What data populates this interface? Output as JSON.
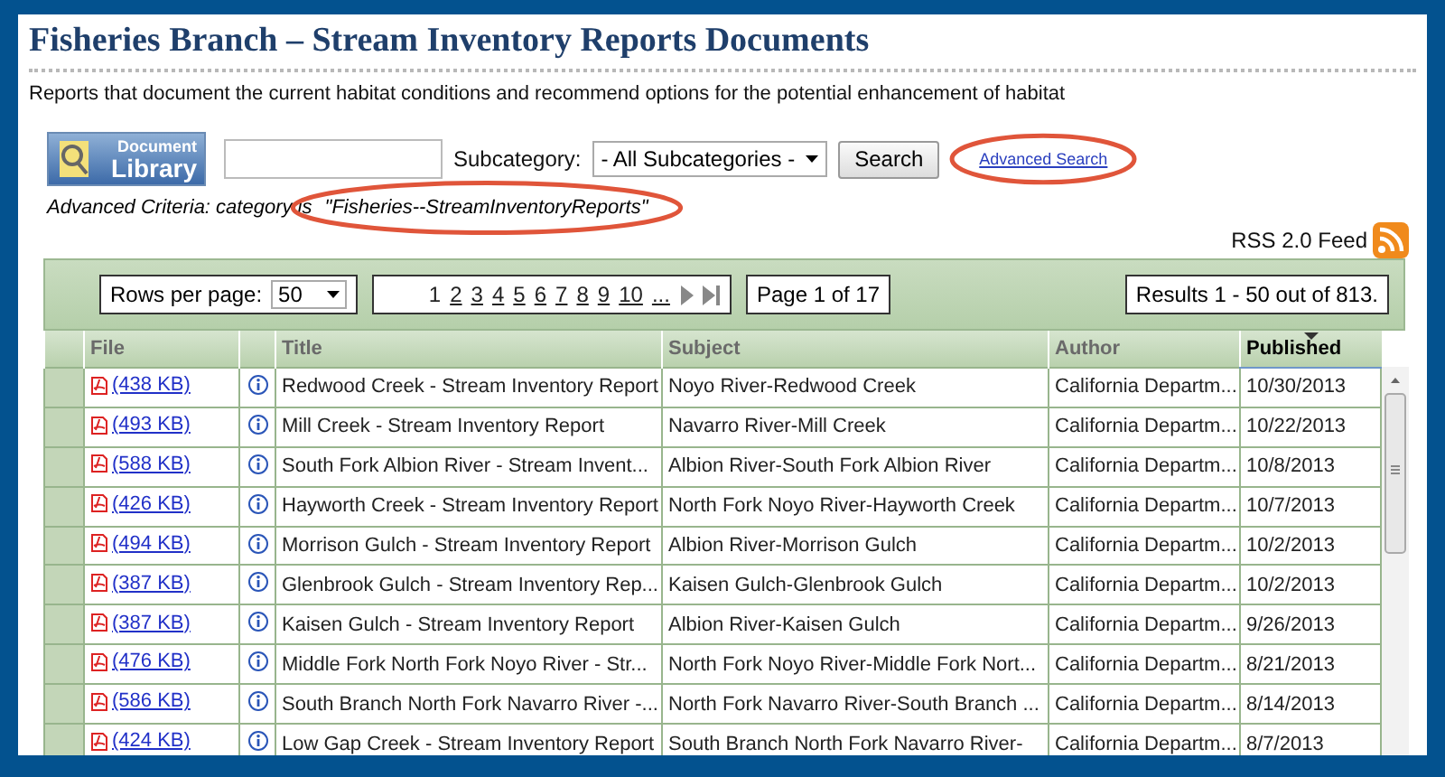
{
  "page": {
    "title": "Fisheries Branch – Stream Inventory Reports Documents",
    "description": "Reports that document the current habitat conditions and recommend options for the potential enhancement of habitat"
  },
  "search": {
    "logo_lines": [
      "Document",
      "Library"
    ],
    "subcategory_label": "Subcategory:",
    "subcategory_value": "- All Subcategories -",
    "button": "Search",
    "advanced_link": "Advanced Search",
    "criteria": "Advanced Criteria: category is",
    "criteria_value": "\"Fisheries--StreamInventoryReports\""
  },
  "rss": {
    "label": "RSS 2.0 Feed"
  },
  "pager": {
    "rows_label": "Rows per page:",
    "rows_value": "50",
    "pages": [
      {
        "label": "1",
        "selected": true
      },
      {
        "label": "2",
        "selected": false
      },
      {
        "label": "3",
        "selected": false
      },
      {
        "label": "4",
        "selected": false
      },
      {
        "label": "5",
        "selected": false
      },
      {
        "label": "6",
        "selected": false
      },
      {
        "label": "7",
        "selected": false
      },
      {
        "label": "8",
        "selected": false
      },
      {
        "label": "9",
        "selected": false
      },
      {
        "label": "10",
        "selected": false
      }
    ],
    "more": "...",
    "page_info": "Page 1 of 17",
    "results": "Results 1 - 50 out of 813."
  },
  "table": {
    "columns": [
      {
        "label": "File",
        "sorted": false
      },
      {
        "label": "Title",
        "sorted": false
      },
      {
        "label": "Subject",
        "sorted": false
      },
      {
        "label": "Author",
        "sorted": false
      },
      {
        "label": "Published",
        "sorted": true
      }
    ],
    "rows": [
      {
        "file": "(438 KB)",
        "title": "Redwood Creek - Stream Inventory Report",
        "subject": "Noyo River-Redwood Creek",
        "author": "California Departm...",
        "published": "10/30/2013"
      },
      {
        "file": "(493 KB)",
        "title": "Mill Creek - Stream Inventory Report",
        "subject": "Navarro River-Mill Creek",
        "author": "California Departm...",
        "published": "10/22/2013"
      },
      {
        "file": "(588 KB)",
        "title": "South Fork Albion River - Stream Invent...",
        "subject": "Albion River-South Fork Albion River",
        "author": "California Departm...",
        "published": "10/8/2013"
      },
      {
        "file": "(426 KB)",
        "title": "Hayworth Creek - Stream Inventory Report",
        "subject": "North Fork Noyo River-Hayworth Creek",
        "author": "California Departm...",
        "published": "10/7/2013"
      },
      {
        "file": "(494 KB)",
        "title": "Morrison Gulch - Stream Inventory Report",
        "subject": "Albion River-Morrison Gulch",
        "author": "California Departm...",
        "published": "10/2/2013"
      },
      {
        "file": "(387 KB)",
        "title": "Glenbrook Gulch - Stream Inventory Rep...",
        "subject": "Kaisen Gulch-Glenbrook Gulch",
        "author": "California Departm...",
        "published": "10/2/2013"
      },
      {
        "file": "(387 KB)",
        "title": "Kaisen Gulch - Stream Inventory Report",
        "subject": "Albion River-Kaisen Gulch",
        "author": "California Departm...",
        "published": "9/26/2013"
      },
      {
        "file": "(476 KB)",
        "title": "Middle Fork North Fork Noyo River - Str...",
        "subject": "North Fork Noyo River-Middle Fork Nort...",
        "author": "California Departm...",
        "published": "8/21/2013"
      },
      {
        "file": "(586 KB)",
        "title": "South Branch North Fork Navarro River -...",
        "subject": "North Fork Navarro River-South Branch ...",
        "author": "California Departm...",
        "published": "8/14/2013"
      },
      {
        "file": "(424 KB)",
        "title": "Low Gap Creek - Stream Inventory Report",
        "subject": "South Branch North Fork Navarro River-",
        "author": "California Departm...",
        "published": "8/7/2013"
      }
    ]
  }
}
